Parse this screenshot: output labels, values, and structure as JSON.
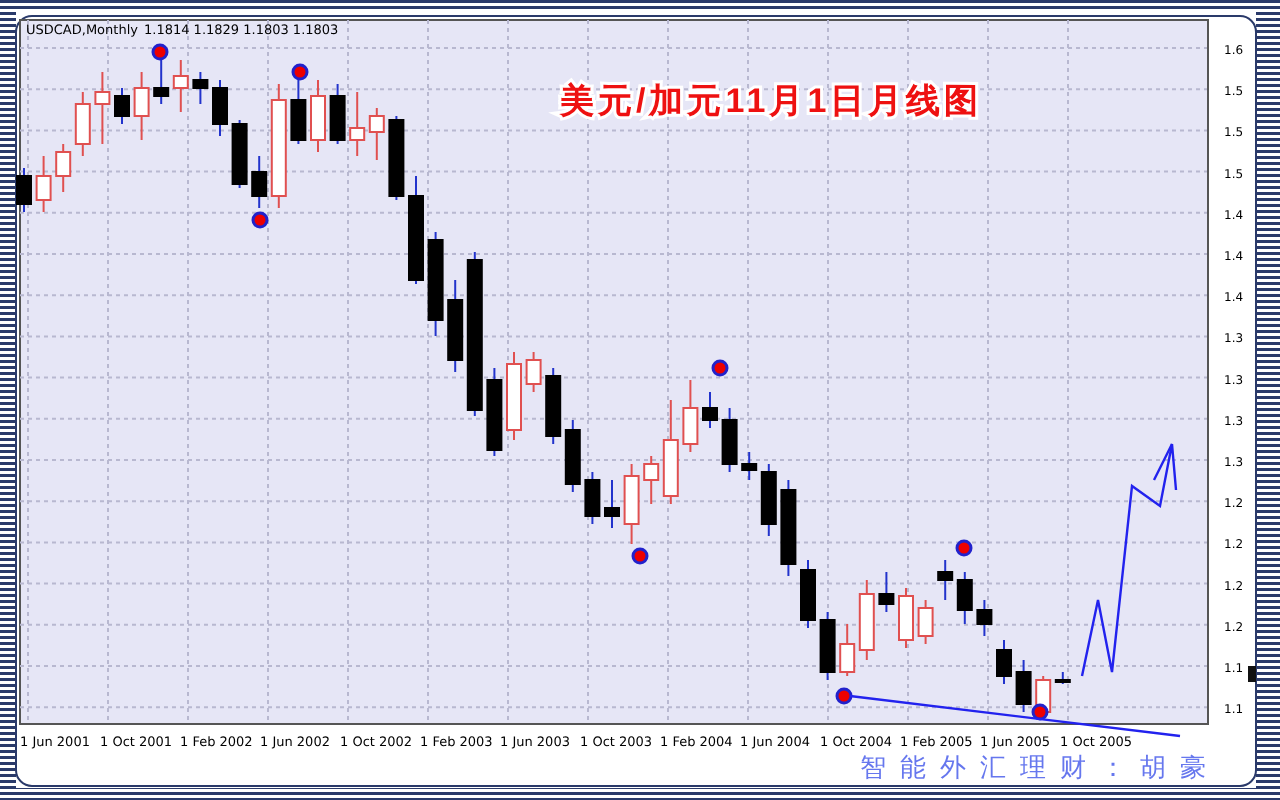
{
  "chart": {
    "symbol": "USDCAD,Monthly",
    "ohlc": "1.1814 1.1829 1.1803 1.1803"
  },
  "overlay_title": "美元/加元11月1日月线图",
  "y_axis": {
    "labels": [
      "1.6",
      "1.5",
      "1.5",
      "1.5",
      "1.4",
      "1.4",
      "1.4",
      "1.3",
      "1.3",
      "1.3",
      "1.3",
      "1.2",
      "1.2",
      "1.2",
      "1.2",
      "1.1",
      "1.1"
    ]
  },
  "x_axis": {
    "labels": [
      "1 Jun 2001",
      "1 Oct 2001",
      "1 Feb 2002",
      "1 Jun 2002",
      "1 Oct 2002",
      "1 Feb 2003",
      "1 Jun 2003",
      "1 Oct 2003",
      "1 Feb 2004",
      "1 Jun 2004",
      "1 Oct 2004",
      "1 Feb 2005",
      "1 Jun 2005",
      "1 Oct 2005"
    ]
  },
  "footer": "智能外汇理财：胡豪"
}
